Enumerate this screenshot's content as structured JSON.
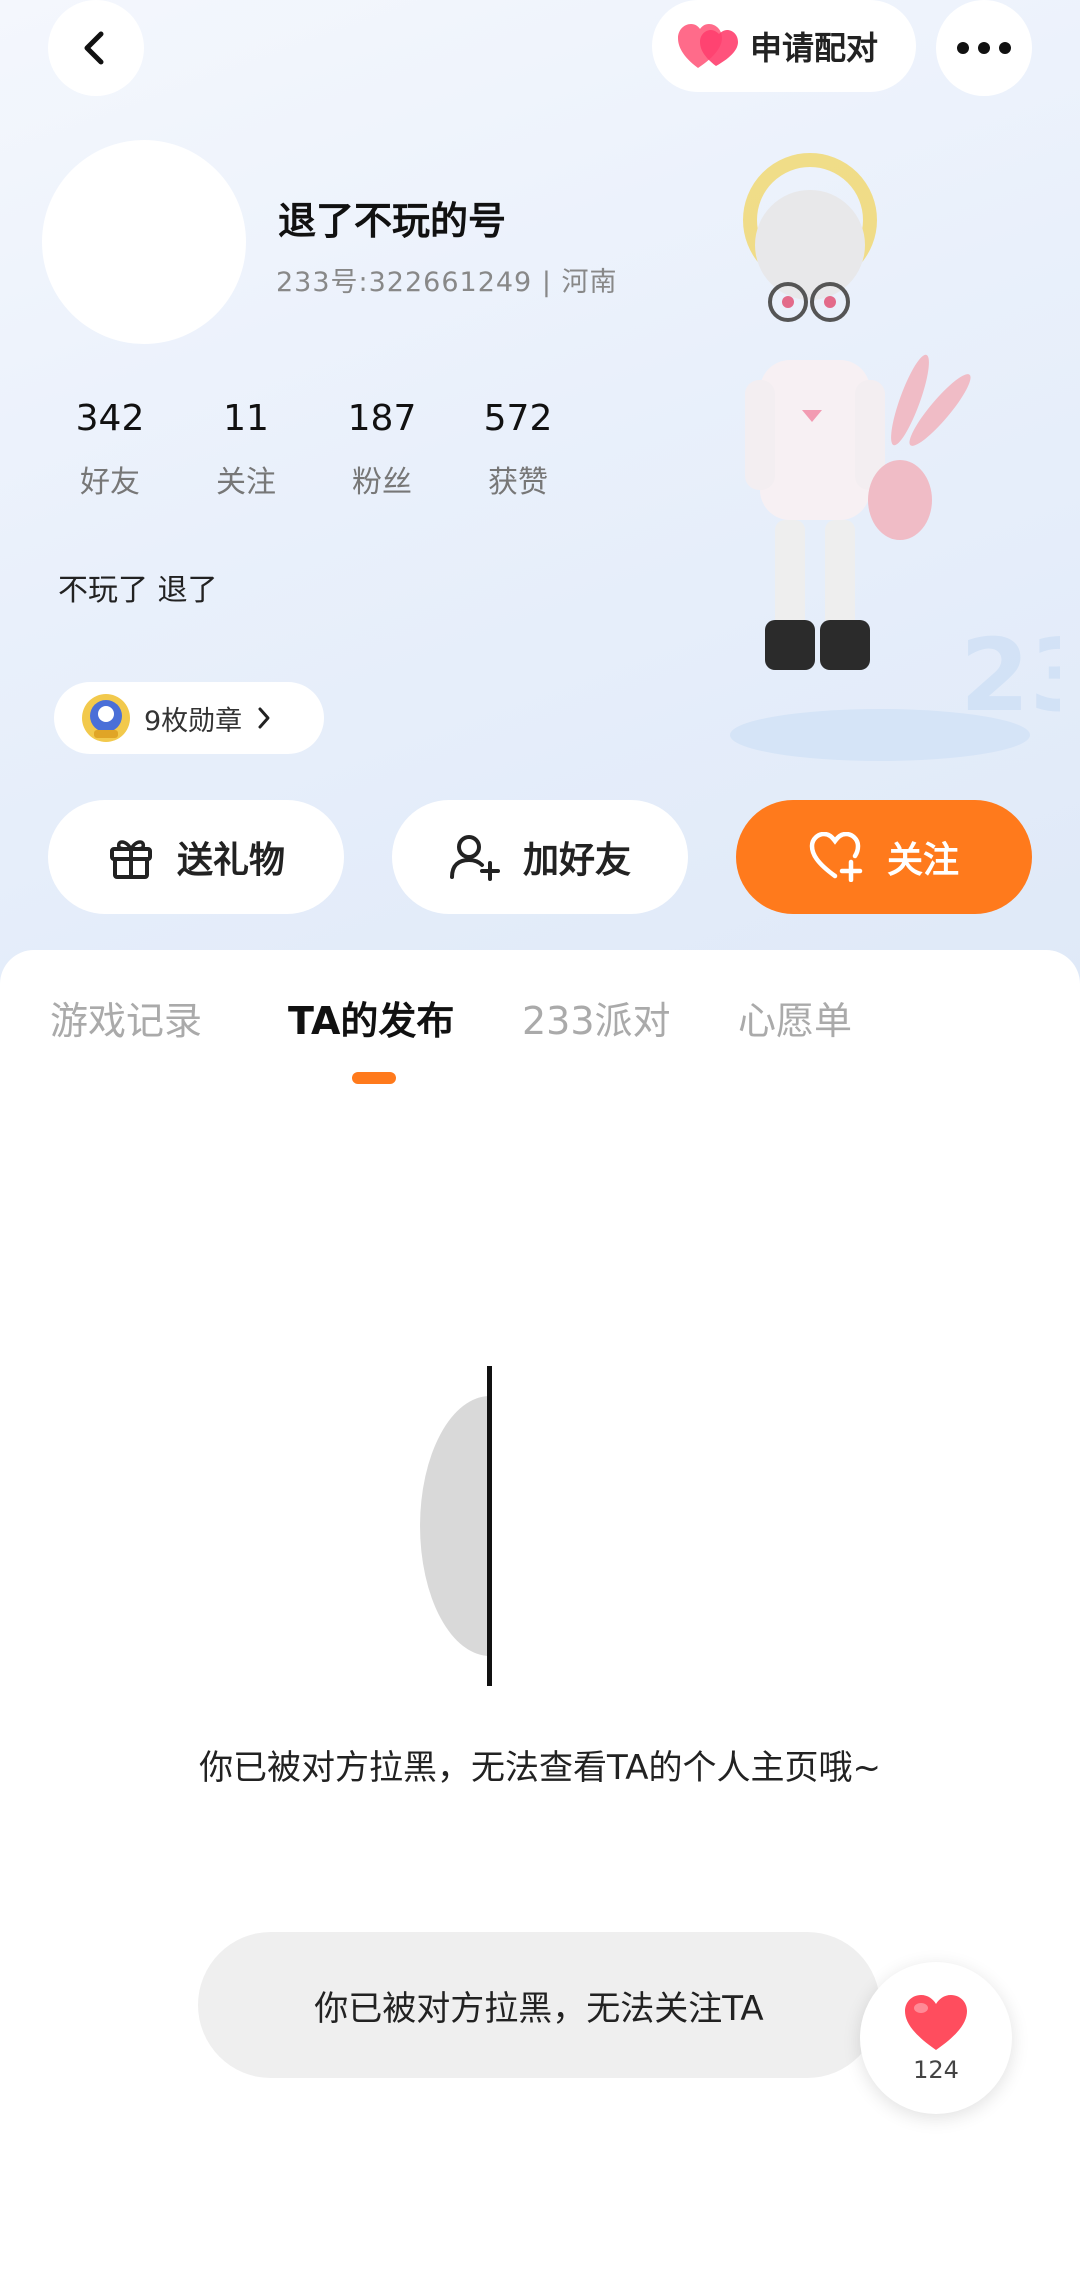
{
  "header": {
    "pair_label": "申请配对"
  },
  "profile": {
    "name": "退了不玩的号",
    "subline": "233号:322661249 | 河南",
    "bio": "不玩了 退了",
    "stats": [
      {
        "num": "342",
        "label": "好友"
      },
      {
        "num": "11",
        "label": "关注"
      },
      {
        "num": "187",
        "label": "粉丝"
      },
      {
        "num": "572",
        "label": "获赞"
      }
    ],
    "badge_label": "9枚勋章"
  },
  "actions": {
    "gift_label": "送礼物",
    "add_friend_label": "加好友",
    "follow_label": "关注"
  },
  "tabs": [
    {
      "label": "游戏记录"
    },
    {
      "label": "TA的发布"
    },
    {
      "label": "233派对"
    },
    {
      "label": "心愿单"
    }
  ],
  "active_tab": "TA的发布",
  "empty_state": {
    "message": "你已被对方拉黑，无法查看TA的个人主页哦~"
  },
  "toast": {
    "message": "你已被对方拉黑，无法关注TA"
  },
  "like_float": {
    "count": "124"
  },
  "colors": {
    "accent": "#ff7a1c",
    "heart": "#ff4d5e"
  }
}
